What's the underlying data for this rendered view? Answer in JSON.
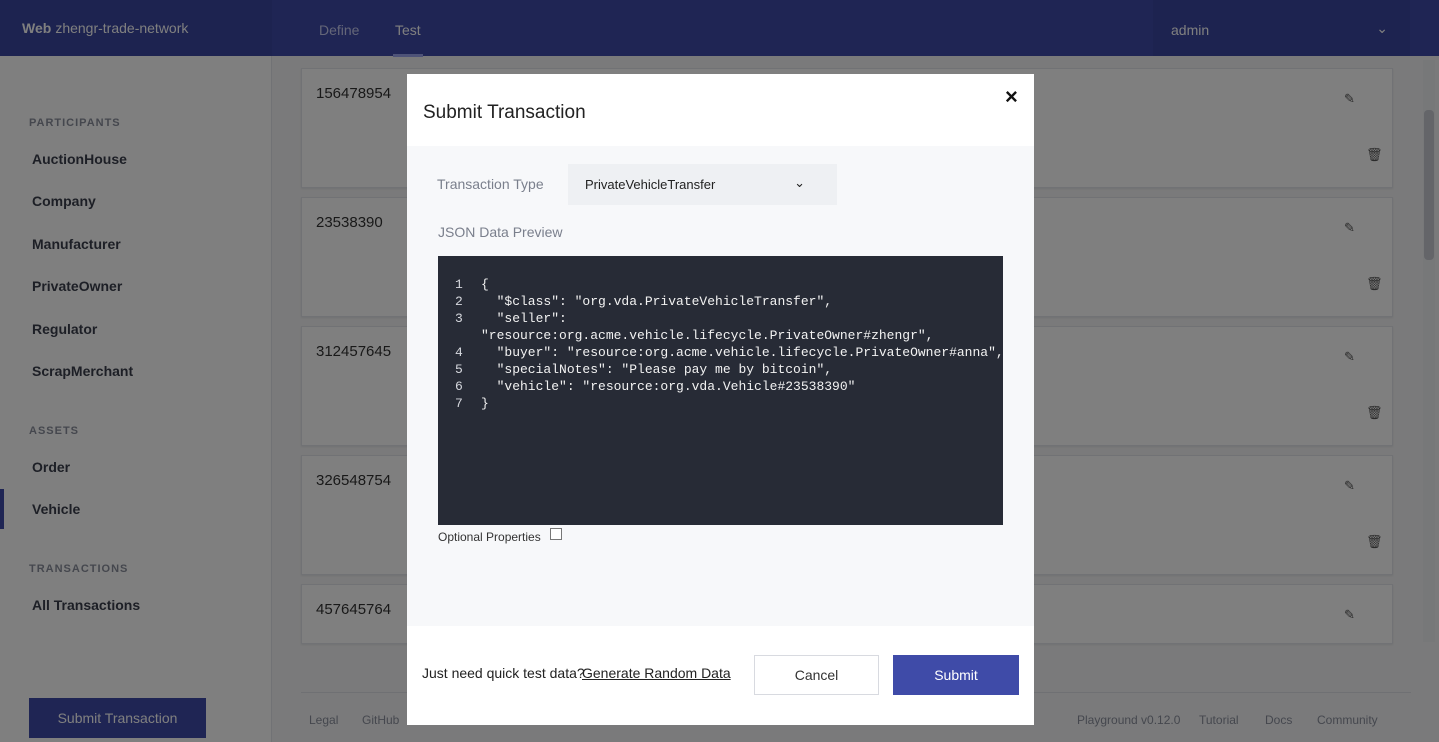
{
  "header": {
    "brand_bold": "Web",
    "brand_name": "zhengr-trade-network",
    "tabs": [
      {
        "label": "Define"
      },
      {
        "label": "Test"
      }
    ],
    "active_tab": "Test",
    "user": "admin"
  },
  "sidebar": {
    "participants_heading": "PARTICIPANTS",
    "participants": [
      "AuctionHouse",
      "Company",
      "Manufacturer",
      "PrivateOwner",
      "Regulator",
      "ScrapMerchant"
    ],
    "assets_heading": "ASSETS",
    "assets": [
      "Order",
      "Vehicle"
    ],
    "active_item": "Vehicle",
    "transactions_heading": "TRANSACTIONS",
    "transactions": [
      "All Transactions"
    ],
    "submit_label": "Submit Transaction"
  },
  "list": {
    "ids": [
      "156478954",
      "23538390",
      "312457645",
      "326548754",
      "457645764"
    ]
  },
  "footer": {
    "left": [
      "Legal",
      "GitHub"
    ],
    "right": [
      "Playground v0.12.0",
      "Tutorial",
      "Docs",
      "Community"
    ]
  },
  "modal": {
    "title": "Submit Transaction",
    "transaction_type_label": "Transaction Type",
    "transaction_type_value": "PrivateVehicleTransfer",
    "json_label": "JSON Data Preview",
    "code_lines": [
      {
        "n": "1",
        "text": "{"
      },
      {
        "n": "2",
        "text": "  \"$class\": \"org.vda.PrivateVehicleTransfer\","
      },
      {
        "n": "3",
        "text": "  \"seller\":"
      },
      {
        "n": "",
        "text": "\"resource:org.acme.vehicle.lifecycle.PrivateOwner#zhengr\","
      },
      {
        "n": "4",
        "text": "  \"buyer\": \"resource:org.acme.vehicle.lifecycle.PrivateOwner#anna\","
      },
      {
        "n": "5",
        "text": "  \"specialNotes\": \"Please pay me by bitcoin\","
      },
      {
        "n": "6",
        "text": "  \"vehicle\": \"resource:org.vda.Vehicle#23538390\""
      },
      {
        "n": "7",
        "text": "}"
      }
    ],
    "optional_label": "Optional Properties",
    "optional_checked": false,
    "quick_text": "Just need quick test data?",
    "generate_link": "Generate Random Data",
    "cancel_label": "Cancel",
    "submit_label": "Submit"
  }
}
